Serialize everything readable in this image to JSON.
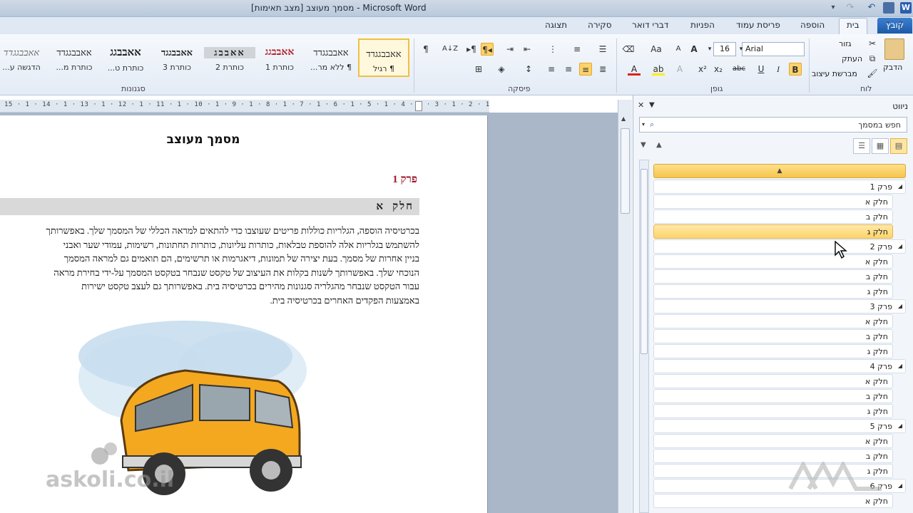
{
  "window": {
    "title": "מסמך מעוצב [מצב תאימות] - Microsoft Word",
    "minimize": "–",
    "restore": "❐",
    "close": "✕",
    "help": "?"
  },
  "tabs": {
    "file": "קובץ",
    "home": "בית",
    "insert": "הוספה",
    "page_layout": "פריסת עמוד",
    "references": "הפניות",
    "mailings": "דברי דואר",
    "review": "סקירה",
    "view": "תצוגה"
  },
  "ribbon": {
    "clipboard": {
      "label": "לוח",
      "paste": "הדבק",
      "cut": "גזור",
      "copy": "העתק",
      "format_painter": "מברשת עיצוב"
    },
    "font": {
      "label": "גופן",
      "font_name": "Arial",
      "font_size": "16",
      "bold": "B",
      "italic": "I",
      "underline": "U",
      "strike": "abc",
      "subscript": "x₂",
      "superscript": "x²",
      "grow": "A",
      "shrink": "A",
      "change_case": "Aa",
      "font_color": "A",
      "highlight": "ab"
    },
    "paragraph": {
      "label": "פיסקה",
      "show_marks": "¶",
      "sort": "A↓Z"
    },
    "styles": {
      "label": "סגנונות",
      "items": [
        {
          "sample": "אאבבגגדד",
          "name": "¶ רגיל"
        },
        {
          "sample": "אאבבגגדד",
          "name": "¶ ללא מר..."
        },
        {
          "sample": "אאבבגג",
          "name": "כותרת 1"
        },
        {
          "sample": "אאבבג",
          "name": "כותרת 2"
        },
        {
          "sample": "אאבבגגד",
          "name": "כותרת 3"
        },
        {
          "sample": "אאבבגג",
          "name": "כותרת ט..."
        },
        {
          "sample": "אאבבגגדד",
          "name": "כותרת מ..."
        },
        {
          "sample": "אאבבגגדד",
          "name": "הדגשה ע..."
        }
      ]
    }
  },
  "ruler": {
    "numbers": "15 · 1 · 14 · 1 · 13 · 1 · 12 · 1 · 11 · 1 · 10 · 1 · 9 · 1 · 8 · 1 · 7 · 1 · 6 · 1 · 5 · 1 · 4 · 1 · 3 · 1 · 2 · 1 · 1"
  },
  "document": {
    "title": "מסמך מעוצב",
    "chapter": "פרק 1",
    "section": "חלק א",
    "paragraph_lines": [
      "בכרטיסיה הוספה, הגלריות כוללות פריטים שעוצבו כדי להתאים למראה הכללי של המסמך שלך. באפשרותך",
      "להשתמש בגלריות אלה להוספת טבלאות, כותרות עליונות, כותרות תחתונות, רשימות, עמודי שער ואבני",
      "בניין אחרות של מסמך. בעת יצירה של תמונות, דיאגרמות או תרשימים, הם תואמים גם למראה המסמך",
      "הנוכחי שלך. באפשרותך לשנות בקלות את העיצוב של טקסט שנבחר בטקסט המסמך על-ידי בחירת מראה",
      "עבור הטקסט שנבחר מהגלריה סגנונות מהירים בכרטיסיה בית. באפשרותך גם לעצב טקסט ישירות",
      "באמצעות הפקדים האחרים בכרטיסיה בית."
    ],
    "watermark": "askoli.co.il"
  },
  "navigation": {
    "title": "ניווט",
    "search_placeholder": "חפש במסמך",
    "items": [
      {
        "type": "chapter",
        "label": "פרק 1"
      },
      {
        "type": "section",
        "label": "חלק א"
      },
      {
        "type": "section",
        "label": "חלק ב"
      },
      {
        "type": "section",
        "label": "חלק ג",
        "selected": true
      },
      {
        "type": "chapter",
        "label": "פרק 2"
      },
      {
        "type": "section",
        "label": "חלק א"
      },
      {
        "type": "section",
        "label": "חלק ב"
      },
      {
        "type": "section",
        "label": "חלק ג"
      },
      {
        "type": "chapter",
        "label": "פרק 3"
      },
      {
        "type": "section",
        "label": "חלק א"
      },
      {
        "type": "section",
        "label": "חלק ב"
      },
      {
        "type": "section",
        "label": "חלק ג"
      },
      {
        "type": "chapter",
        "label": "פרק 4"
      },
      {
        "type": "section",
        "label": "חלק א"
      },
      {
        "type": "section",
        "label": "חלק ב"
      },
      {
        "type": "section",
        "label": "חלק ג"
      },
      {
        "type": "chapter",
        "label": "פרק 5"
      },
      {
        "type": "section",
        "label": "חלק א"
      },
      {
        "type": "section",
        "label": "חלק ב"
      },
      {
        "type": "section",
        "label": "חלק ג"
      },
      {
        "type": "chapter",
        "label": "פרק 6"
      },
      {
        "type": "section",
        "label": "חלק א"
      }
    ]
  },
  "colors": {
    "chapter_red": "#a0182a",
    "selection_yellow": "#fdd46a",
    "ribbon_blue": "#1d5aa8"
  }
}
